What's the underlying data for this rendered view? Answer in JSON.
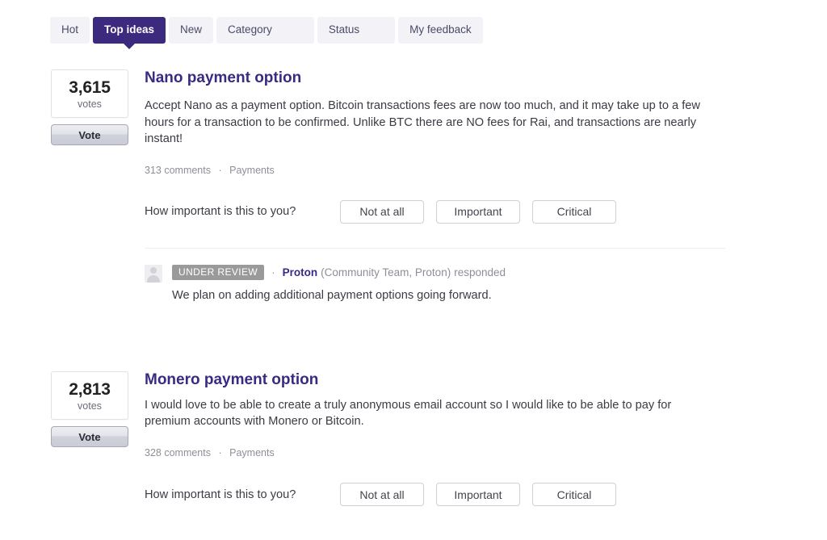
{
  "tabs": [
    {
      "label": "Hot",
      "active": false
    },
    {
      "label": "Top ideas",
      "active": true
    },
    {
      "label": "New",
      "active": false
    },
    {
      "label": "Category",
      "active": false
    },
    {
      "label": "Status",
      "active": false
    },
    {
      "label": "My feedback",
      "active": false
    }
  ],
  "colors": {
    "accent": "#3a2a82",
    "active_tab_bg": "#3b2a7e",
    "tab_bg": "#f3f3f7",
    "badge_bg": "#9a9a9a",
    "text": "#3b3b44",
    "muted": "#8e8e99"
  },
  "importance": {
    "question": "How important is this to you?",
    "options": [
      "Not at all",
      "Important",
      "Critical"
    ]
  },
  "vote_button_label": "Vote",
  "votes_label": "votes",
  "ideas": [
    {
      "votes": "3,615",
      "title": "Nano payment option",
      "description": "Accept Nano as a payment option. Bitcoin transactions fees are now too much, and it may take up to a few hours for a transaction to be confirmed. Unlike BTC there are NO fees for Rai, and transactions are nearly instant!",
      "comments": "313 comments",
      "separator": "·",
      "category": "Payments",
      "response": {
        "status_badge": "UNDER REVIEW",
        "separator": "·",
        "author": "Proton",
        "role": "(Community Team, Proton)",
        "verb": "responded",
        "text": "We plan on adding additional payment options going forward.",
        "avatar_icon": "user-avatar-icon"
      }
    },
    {
      "votes": "2,813",
      "title": "Monero payment option",
      "description": "I would love to be able to create a truly anonymous email account so I would like to be able to pay for premium accounts with Monero or Bitcoin.",
      "comments": "328 comments",
      "separator": "·",
      "category": "Payments",
      "response": null
    }
  ]
}
